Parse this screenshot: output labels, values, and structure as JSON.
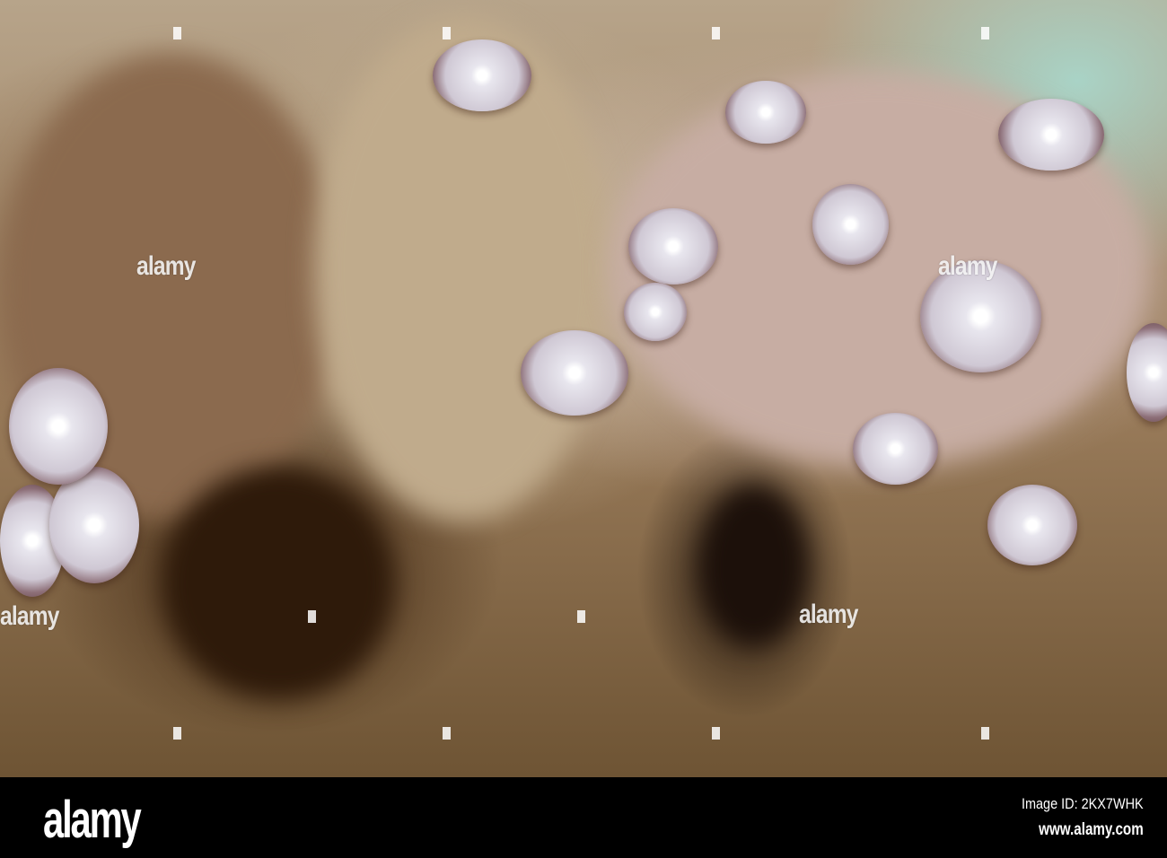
{
  "photo": {
    "subject": "octopus-tentacles",
    "watermark_text": "alamy"
  },
  "footer": {
    "logo": "alamy",
    "image_id": "Image ID: 2KX7WHK",
    "website": "www.alamy.com"
  }
}
